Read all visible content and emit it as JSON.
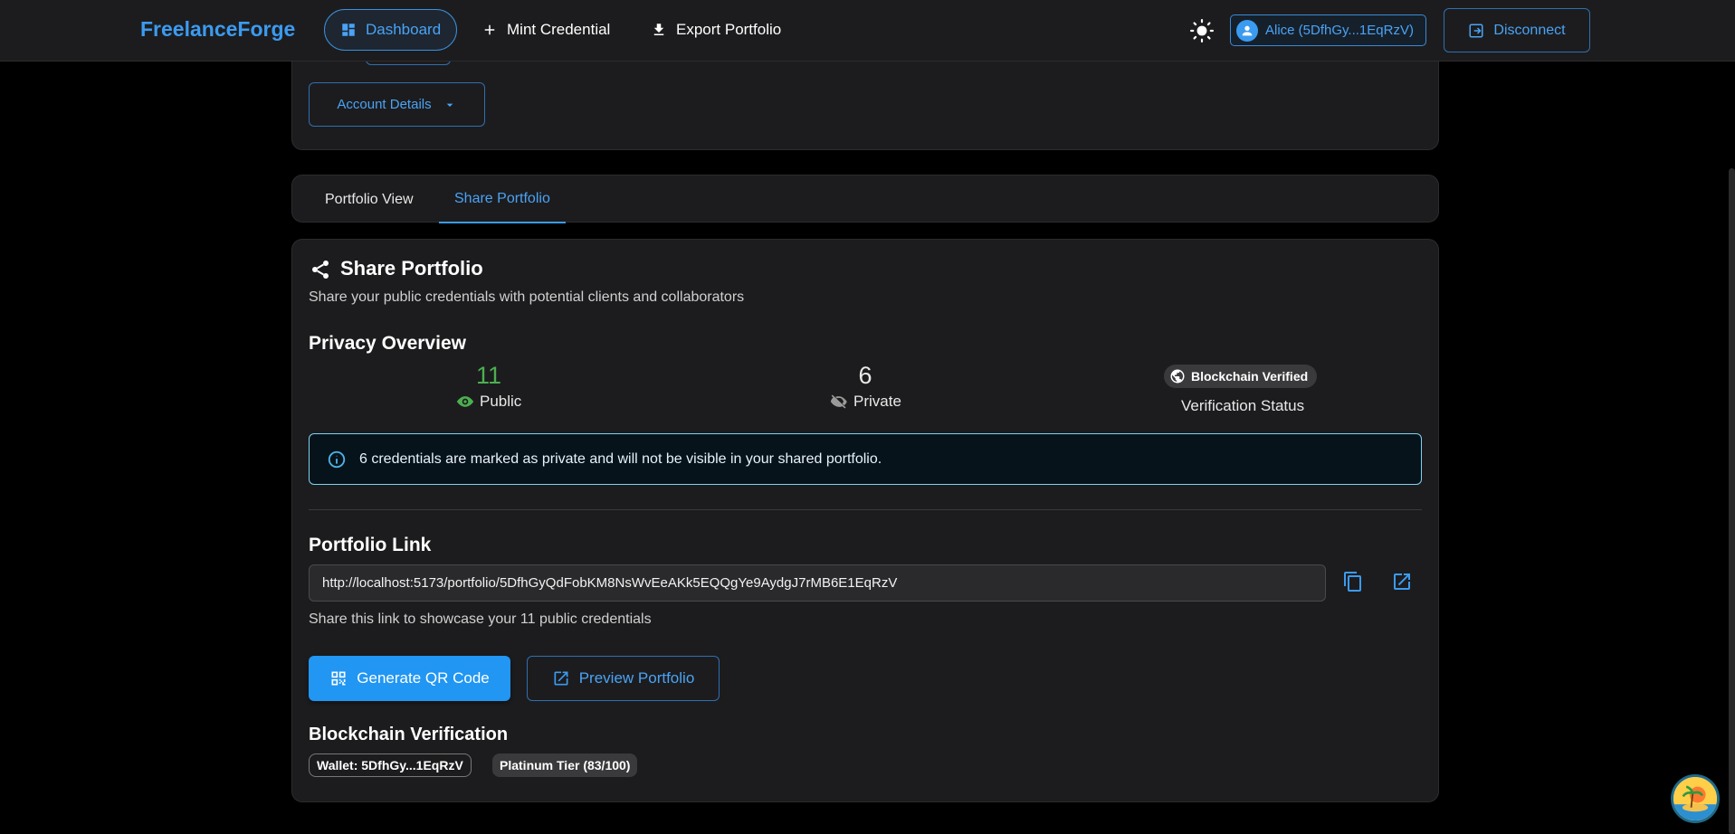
{
  "appbar": {
    "brand": "FreelanceForge",
    "nav": [
      {
        "label": "Dashboard",
        "icon": "dashboard-icon",
        "active": true
      },
      {
        "label": "Mint Credential",
        "icon": "plus-icon"
      },
      {
        "label": "Export Portfolio",
        "icon": "download-icon"
      }
    ],
    "account_label": "Alice (5DfhGy...1EqRzV)",
    "disconnect_label": "Disconnect"
  },
  "account_details_label": "Account Details",
  "tabs": [
    {
      "label": "Portfolio View"
    },
    {
      "label": "Share Portfolio",
      "active": true
    }
  ],
  "share": {
    "title": "Share Portfolio",
    "subtitle": "Share your public credentials with potential clients and collaborators",
    "privacy_title": "Privacy Overview",
    "public_count": "11",
    "public_label": "Public",
    "private_count": "6",
    "private_label": "Private",
    "verified_chip": "Blockchain Verified",
    "verification_label": "Verification Status",
    "info_text": "6 credentials are marked as private and will not be visible in your shared portfolio.",
    "link_title": "Portfolio Link",
    "link_value": "http://localhost:5173/portfolio/5DfhGyQdFobKM8NsWvEeAKk5EQQgYe9AydgJ7rMB6E1EqRzV",
    "link_help": "Share this link to showcase your 11 public credentials",
    "qr_button": "Generate QR Code",
    "preview_button": "Preview Portfolio",
    "blockchain_title": "Blockchain Verification",
    "wallet_chip": "Wallet: 5DfhGy...1EqRzV",
    "tier_chip": "Platinum Tier (83/100)"
  },
  "colors": {
    "accent": "#3b9bf0",
    "public_green": "#4caf50",
    "background": "#000000",
    "card": "#1c1c1e"
  }
}
